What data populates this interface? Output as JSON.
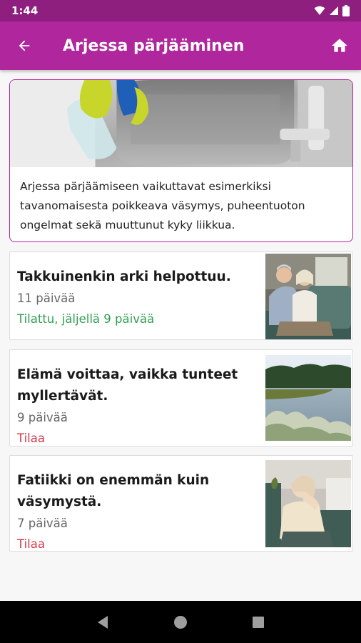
{
  "status_bar": {
    "time": "1:44",
    "icons": [
      "wifi-icon",
      "signal-icon",
      "battery-icon"
    ]
  },
  "app_bar": {
    "title": "Arjessa pärjääminen",
    "back_icon": "arrow-back-icon",
    "home_icon": "home-icon",
    "background_color": "#b0279d"
  },
  "intro": {
    "image": "sink-cleaning-photo",
    "text": "Arjessa pärjäämiseen vaikuttavat esimerkiksi tavanomaisesta poikkeava väsymys, puheentuoton ongelmat sekä muuttunut kyky liikkua."
  },
  "courses": [
    {
      "title": "Takkuinenkin arki helpottuu.",
      "days": "11 päivää",
      "status": "Tilattu, jäljellä 9 päivää",
      "status_color": "#2e9e4f",
      "image": "elderly-couple-photo"
    },
    {
      "title": "Elämä voittaa, vaikka tunteet myllertävät.",
      "days": "9 päivää",
      "status": "Tilaa",
      "status_color": "#d13a48",
      "image": "lake-landscape-photo"
    },
    {
      "title": "Fatiikki on enemmän kuin väsymystä.",
      "days": "7 päivää",
      "status": "Tilaa",
      "status_color": "#d13a48",
      "image": "tired-woman-photo"
    }
  ],
  "nav_bar": {
    "icons": [
      "nav-back-icon",
      "nav-home-icon",
      "nav-recents-icon"
    ]
  }
}
